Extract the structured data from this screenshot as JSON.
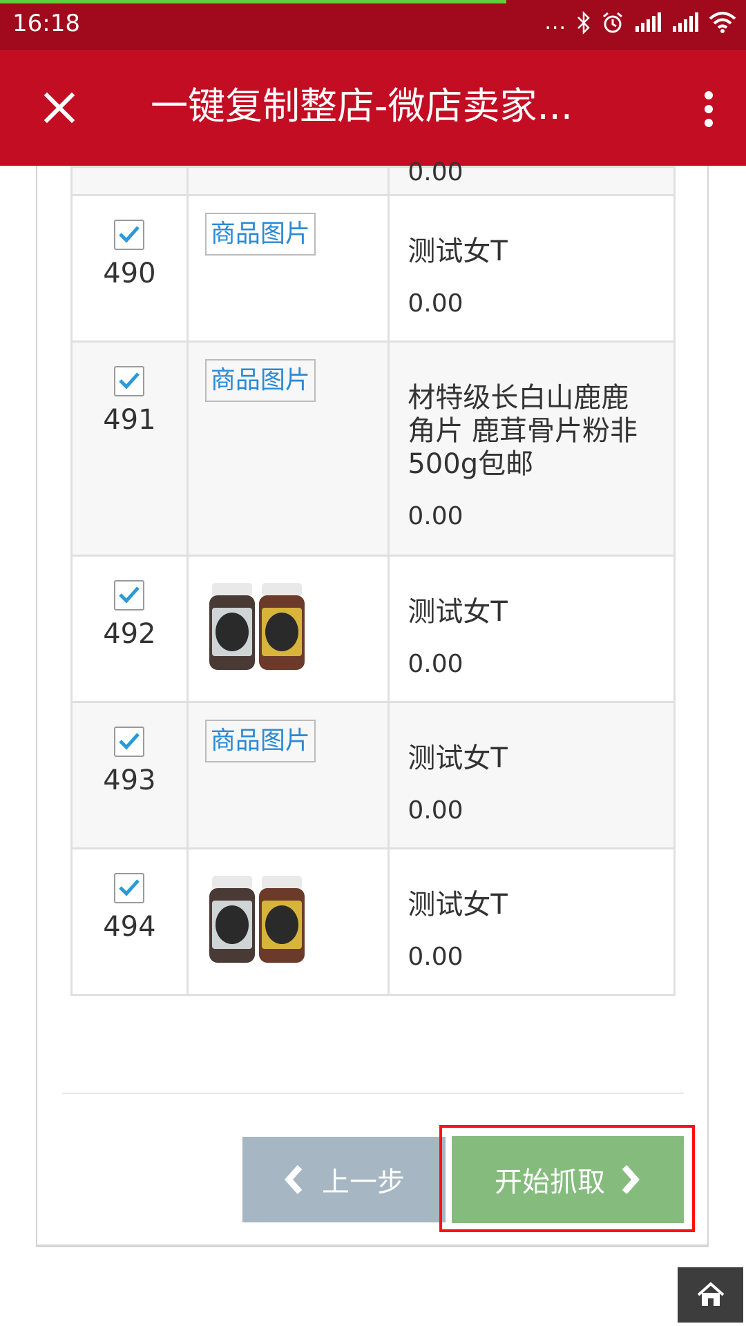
{
  "status_bar": {
    "time": "16:18",
    "more": "..."
  },
  "title_bar": {
    "title": "一键复制整店-微店卖家..."
  },
  "table": {
    "partial_row": {
      "price": "0.00"
    },
    "rows": [
      {
        "index": "490",
        "checked": true,
        "image": "link",
        "image_label": "商品图片",
        "name": "测试女T",
        "price": "0.00"
      },
      {
        "index": "491",
        "checked": true,
        "image": "link",
        "image_label": "商品图片",
        "name": "材特级长白山鹿鹿角片 鹿茸骨片粉非500g包邮",
        "price": "0.00"
      },
      {
        "index": "492",
        "checked": true,
        "image": "thumbnail",
        "name": "测试女T",
        "price": "0.00"
      },
      {
        "index": "493",
        "checked": true,
        "image": "link",
        "image_label": "商品图片",
        "name": "测试女T",
        "price": "0.00"
      },
      {
        "index": "494",
        "checked": true,
        "image": "thumbnail",
        "name": "测试女T",
        "price": "0.00"
      }
    ]
  },
  "buttons": {
    "prev_label": "上一步",
    "start_label": "开始抓取"
  },
  "colors": {
    "status_bar": "#a00a1c",
    "title_bar": "#c30d23",
    "link": "#2b8ad7",
    "checkbox_tick": "#2b9ad8",
    "prev_button": "#a6b6c2",
    "start_button": "#85bc7e",
    "highlight": "#ff1010"
  }
}
